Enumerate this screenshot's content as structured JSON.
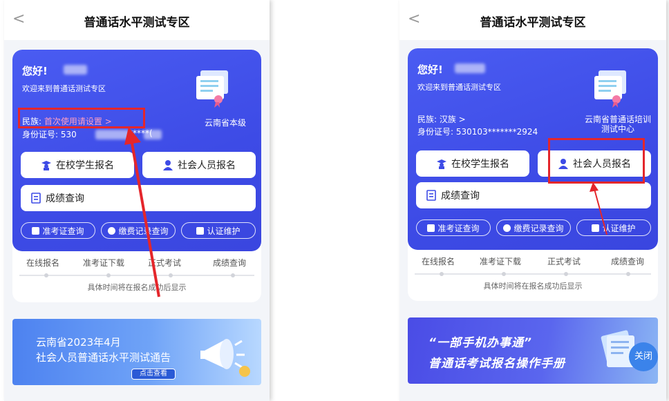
{
  "nav": {
    "back": "<",
    "title": "普通话水平测试专区"
  },
  "left": {
    "greeting": "您好!",
    "welcome": "欢迎来到普通话测试专区",
    "ethnicity_label": "民族:",
    "ethnicity_value": "首次使用请设置 >",
    "id_label": "身份证号:",
    "id_value": "530",
    "id_tail": "*****(",
    "region": "云南省本级",
    "student_btn": "在校学生报名",
    "social_btn": "社会人员报名",
    "score_btn": "成绩查询",
    "pills": [
      "准考证查询",
      "缴费记录查询",
      "认证维护"
    ],
    "steps": [
      "在线报名",
      "准考证下载",
      "正式考试",
      "成绩查询"
    ],
    "hint": "具体时间将在报名成功后显示",
    "banner": {
      "line1": "云南省2023年4月",
      "line2": "社会人员普通话水平测试通告",
      "button": "点击查看"
    }
  },
  "right": {
    "greeting": "您好!",
    "welcome": "欢迎来到普通话测试专区",
    "ethnicity": "民族: 汉族 >",
    "id": "身份证号: 530103*******2924",
    "region_line1": "云南省普通话培训",
    "region_line2": "测试中心",
    "student_btn": "在校学生报名",
    "social_btn": "社会人员报名",
    "score_btn": "成绩查询",
    "pills": [
      "准考证查询",
      "缴费记录查询",
      "认证维护"
    ],
    "steps": [
      "在线报名",
      "准考证下载",
      "正式考试",
      "成绩查询"
    ],
    "hint": "具体时间将在报名成功后显示",
    "banner": {
      "line1": "“一部手机办事通”",
      "line2": "普通话考试报名操作手册",
      "close": "关闭"
    }
  },
  "colors": {
    "card_blue": "#4453ea",
    "highlight": "#e4262b",
    "link_pink": "#ff9ec1"
  },
  "icons": [
    "student-icon",
    "person-icon",
    "document-icon",
    "id-card-icon",
    "coin-icon",
    "card-icon",
    "certificate-icon",
    "megaphone-icon"
  ]
}
